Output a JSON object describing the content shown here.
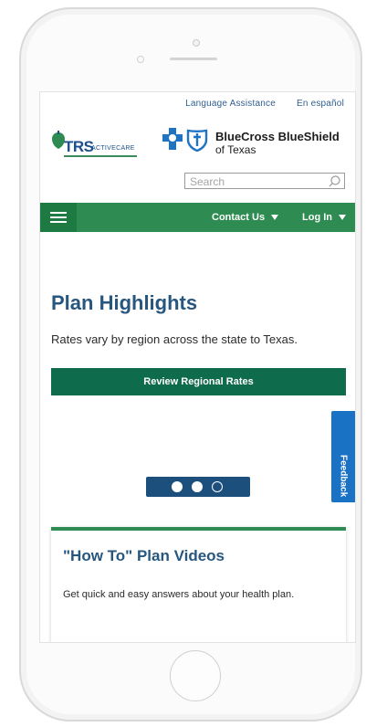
{
  "utility": {
    "language_assistance": "Language Assistance",
    "espanol": "En español"
  },
  "logos": {
    "trs": "TRS",
    "active_care": "ACTIVECARE",
    "bcbs_name": "BlueCross BlueShield",
    "bcbs_sub": "of Texas"
  },
  "search": {
    "placeholder": "Search"
  },
  "nav": {
    "contact_us": "Contact Us",
    "log_in": "Log In"
  },
  "hero": {
    "title": "Plan Highlights",
    "text": "Rates vary by region across the state to Texas.",
    "button": "Review Regional Rates"
  },
  "carousel": {
    "slides": 3,
    "active_slide": 1
  },
  "feedback": {
    "label": "Feedback"
  },
  "video_card": {
    "title": "\"How To\" Plan Videos",
    "text": "Get quick and easy answers about your health plan."
  },
  "colors": {
    "nav_green": "#2e8b52",
    "button_green": "#0e6b4b",
    "title_blue": "#27567f",
    "feedback_blue": "#1a72c4",
    "dots_blue": "#1c4f7c"
  }
}
